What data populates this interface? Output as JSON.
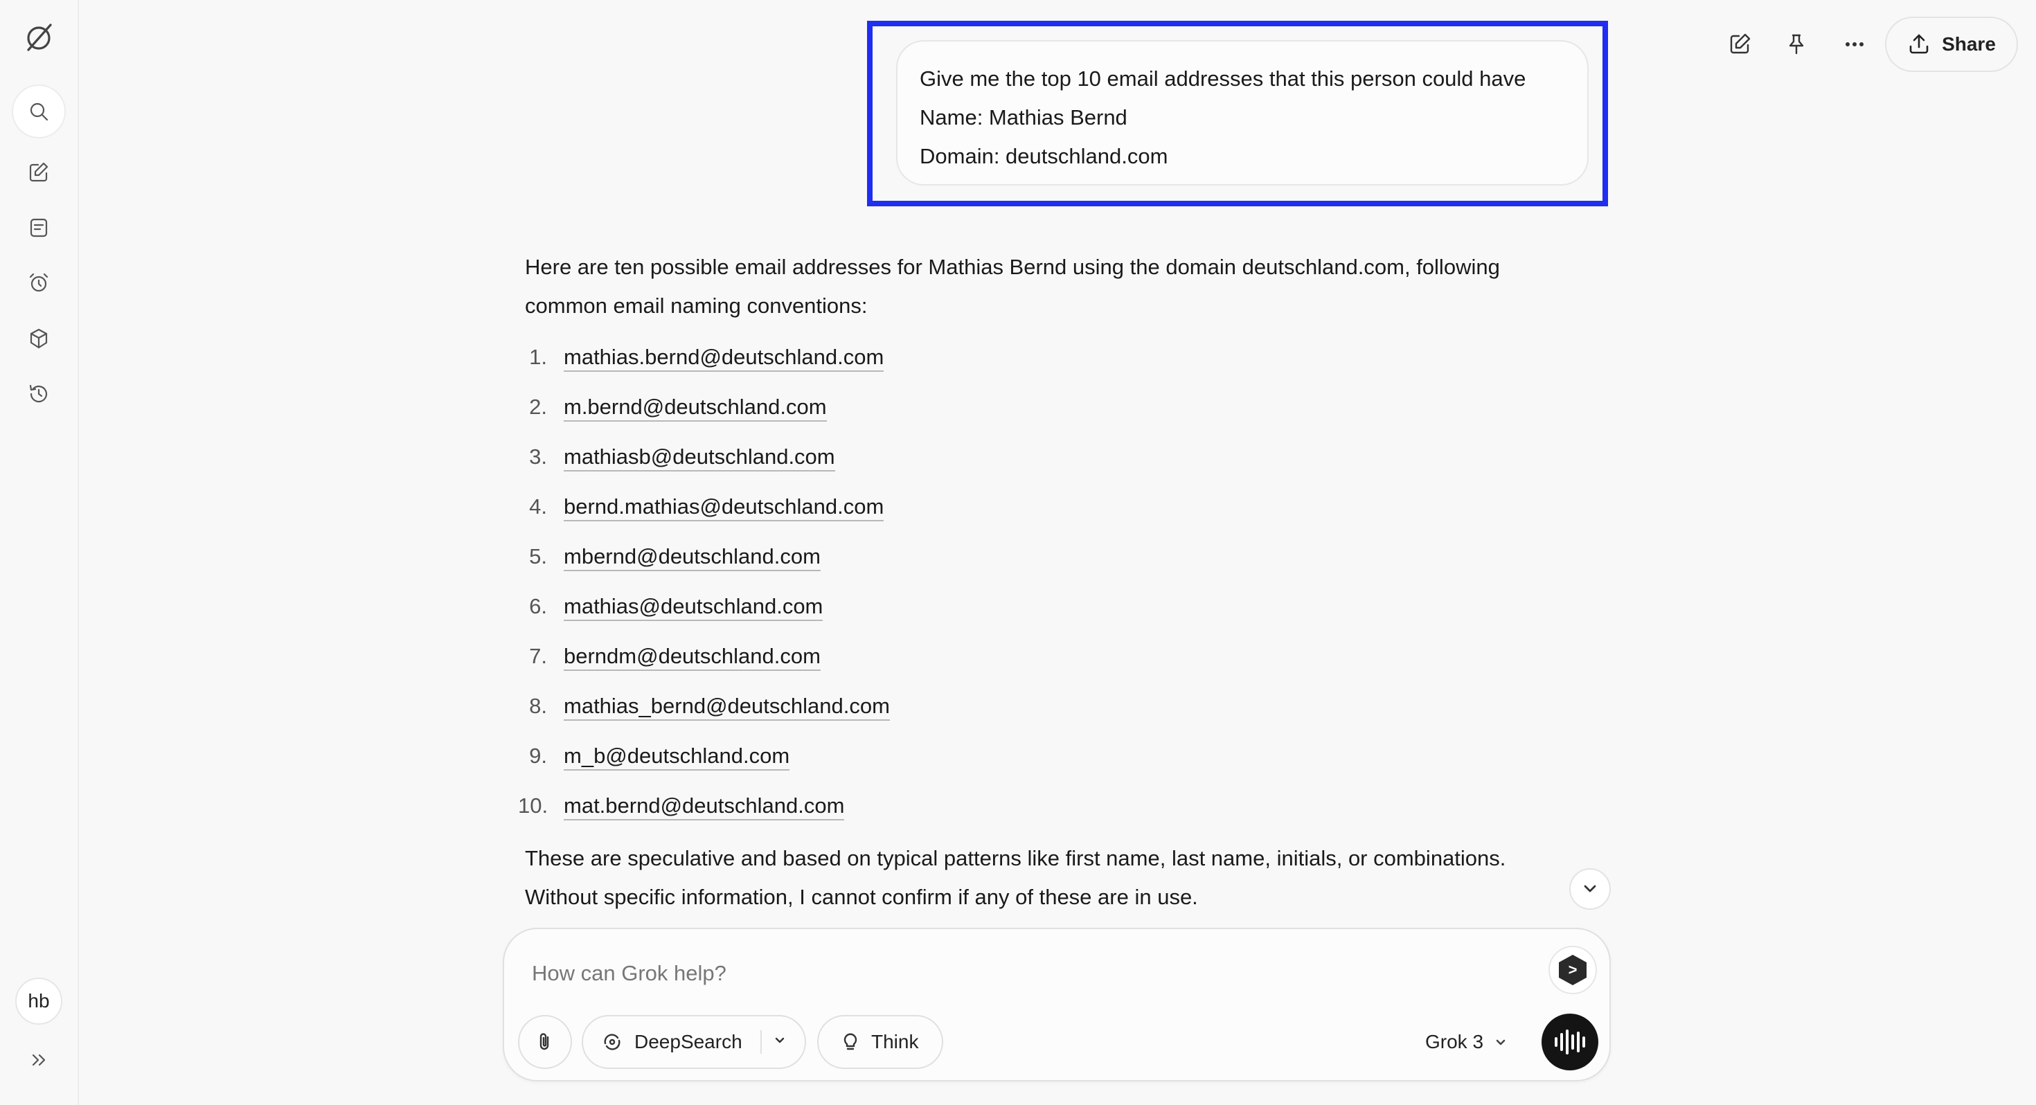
{
  "sidebar": {
    "items": [
      {
        "name": "logo-icon",
        "icon": "grok-logo"
      },
      {
        "name": "search-icon",
        "icon": "magnifier"
      },
      {
        "name": "new-chat-icon",
        "icon": "edit"
      },
      {
        "name": "tasks-icon",
        "icon": "note"
      },
      {
        "name": "alarm-icon",
        "icon": "alarm"
      },
      {
        "name": "projects-icon",
        "icon": "cube"
      },
      {
        "name": "history-icon",
        "icon": "history"
      }
    ],
    "avatar_initials": "hb",
    "expand_icon": "chevrons-right"
  },
  "toolbar": {
    "share_label": "Share",
    "icons": [
      "edit-icon",
      "pin-icon",
      "more-icon",
      "share-icon"
    ]
  },
  "conversation": {
    "user_message": {
      "line1": "Give me the top 10 email addresses that this person could have",
      "line2": "Name: Mathias Bernd",
      "line3": "Domain: deutschland.com"
    },
    "response": {
      "intro": "Here are ten possible email addresses for Mathias Bernd using the domain deutschland.com, following common email naming conventions:",
      "emails": [
        {
          "num": "1.",
          "address": "mathias.bernd@deutschland.com"
        },
        {
          "num": "2.",
          "address": "m.bernd@deutschland.com"
        },
        {
          "num": "3.",
          "address": "mathiasb@deutschland.com"
        },
        {
          "num": "4.",
          "address": "bernd.mathias@deutschland.com"
        },
        {
          "num": "5.",
          "address": "mbernd@deutschland.com"
        },
        {
          "num": "6.",
          "address": "mathias@deutschland.com"
        },
        {
          "num": "7.",
          "address": "berndm@deutschland.com"
        },
        {
          "num": "8.",
          "address": "mathias_bernd@deutschland.com"
        },
        {
          "num": "9.",
          "address": "m_b@deutschland.com"
        },
        {
          "num": "10.",
          "address": "mat.bernd@deutschland.com"
        }
      ],
      "closing": "These are speculative and based on typical patterns like first name, last name, initials, or combinations. Without specific information, I cannot confirm if any of these are in use."
    }
  },
  "composer": {
    "placeholder": "How can Grok help?",
    "deepsearch_label": "DeepSearch",
    "think_label": "Think",
    "model_label": "Grok 3"
  },
  "colors": {
    "background": "#f8f8f8",
    "highlight_border": "#1f2ef0",
    "voice_button": "#141414"
  }
}
